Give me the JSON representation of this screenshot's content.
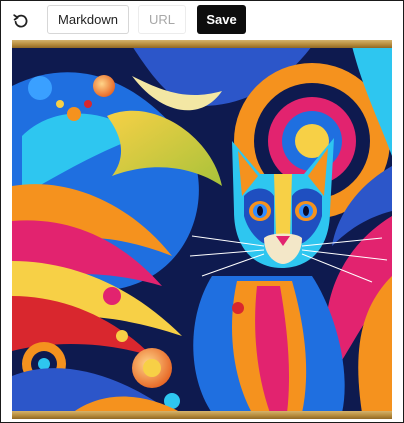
{
  "toolbar": {
    "undo_icon": "undo-icon",
    "markdown_label": "Markdown",
    "url_label": "URL",
    "save_label": "Save"
  },
  "artwork": {
    "subject": "colorful abstract cat illustration",
    "colors": {
      "navy": "#0e1a4f",
      "blue": "#1f6fe0",
      "cyan": "#2ec6f0",
      "orange": "#f5921e",
      "yellow": "#f7d046",
      "pink": "#e2236f",
      "red": "#d9272e"
    }
  }
}
